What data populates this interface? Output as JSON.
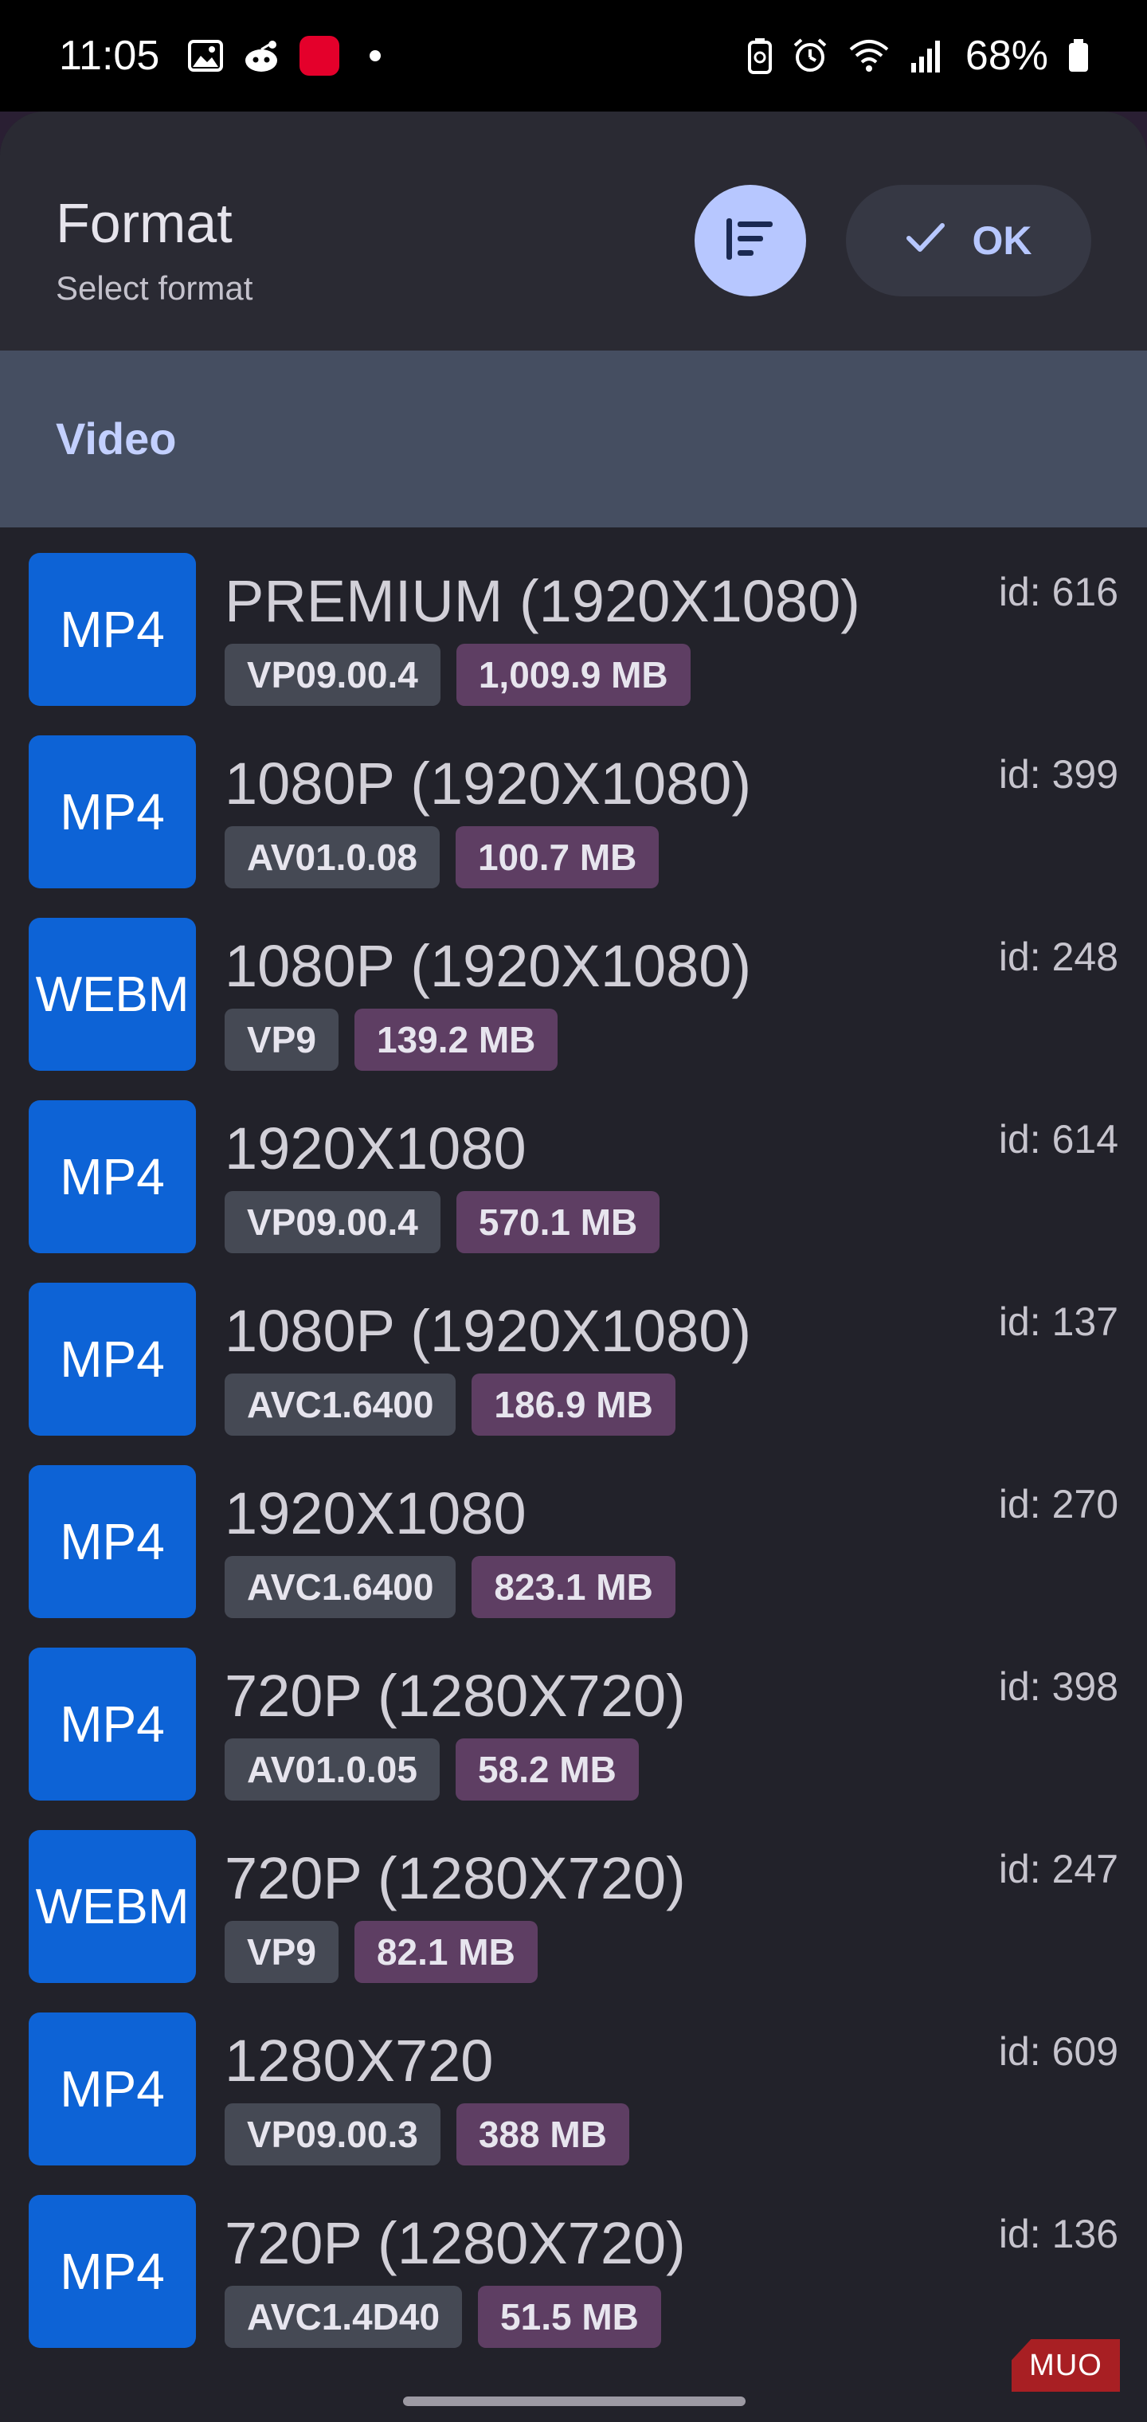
{
  "status_bar": {
    "time": "11:05",
    "battery": "68%"
  },
  "dialog": {
    "title": "Format",
    "subtitle": "Select format",
    "ok_label": "OK"
  },
  "section": {
    "label": "Video"
  },
  "formats": [
    {
      "container": "MP4",
      "resolution": "PREMIUM (1920X1080)",
      "codec": "VP09.00.4",
      "size": "1,009.9 MB",
      "id": "id: 616"
    },
    {
      "container": "MP4",
      "resolution": "1080P (1920X1080)",
      "codec": "AV01.0.08",
      "size": "100.7 MB",
      "id": "id: 399"
    },
    {
      "container": "WEBM",
      "resolution": "1080P (1920X1080)",
      "codec": "VP9",
      "size": "139.2 MB",
      "id": "id: 248"
    },
    {
      "container": "MP4",
      "resolution": "1920X1080",
      "codec": "VP09.00.4",
      "size": "570.1 MB",
      "id": "id: 614"
    },
    {
      "container": "MP4",
      "resolution": "1080P (1920X1080)",
      "codec": "AVC1.6400",
      "size": "186.9 MB",
      "id": "id: 137"
    },
    {
      "container": "MP4",
      "resolution": "1920X1080",
      "codec": "AVC1.6400",
      "size": "823.1 MB",
      "id": "id: 270"
    },
    {
      "container": "MP4",
      "resolution": "720P (1280X720)",
      "codec": "AV01.0.05",
      "size": "58.2 MB",
      "id": "id: 398"
    },
    {
      "container": "WEBM",
      "resolution": "720P (1280X720)",
      "codec": "VP9",
      "size": "82.1 MB",
      "id": "id: 247"
    },
    {
      "container": "MP4",
      "resolution": "1280X720",
      "codec": "VP09.00.3",
      "size": "388 MB",
      "id": "id: 609"
    },
    {
      "container": "MP4",
      "resolution": "720P (1280X720)",
      "codec": "AVC1.4D40",
      "size": "51.5 MB",
      "id": "id: 136"
    }
  ],
  "watermark": "MUO",
  "colors": {
    "accent": "#b7c7ff",
    "badge": "#0d63d6",
    "size_chip": "#5e3e63",
    "codec_chip": "#454954",
    "section_bg": "#454e61"
  },
  "icons": {
    "sort": "sort-icon",
    "ok": "check-icon"
  }
}
